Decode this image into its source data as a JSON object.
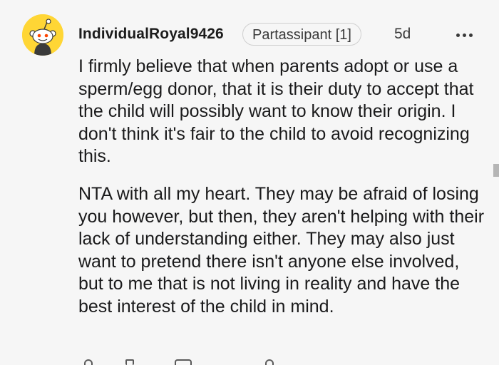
{
  "comment": {
    "username": "IndividualRoyal9426",
    "flair": "Partassipant [1]",
    "timestamp": "5d",
    "paragraphs": [
      "I firmly believe that when parents adopt or use a sperm/egg donor, that it is their duty to accept that the child will possibly want to know their origin. I don't think it's fair to the child to avoid recognizing this.",
      "NTA with all my heart. They may be afraid of losing you however, but then, they aren't helping with their lack of understanding either. They may also just want to pretend there isn't anyone else involved, but to me that is not living in reality and have the best interest of the child in mind."
    ]
  },
  "icons": {
    "avatar": "snoo-avatar-icon",
    "more": "more-options-icon"
  },
  "colors": {
    "background": "#f6f6f6",
    "avatar_background": "#ffd635",
    "text": "#1a1a1b",
    "muted": "#3a3a3a",
    "flair_border": "#cfcfcf"
  }
}
